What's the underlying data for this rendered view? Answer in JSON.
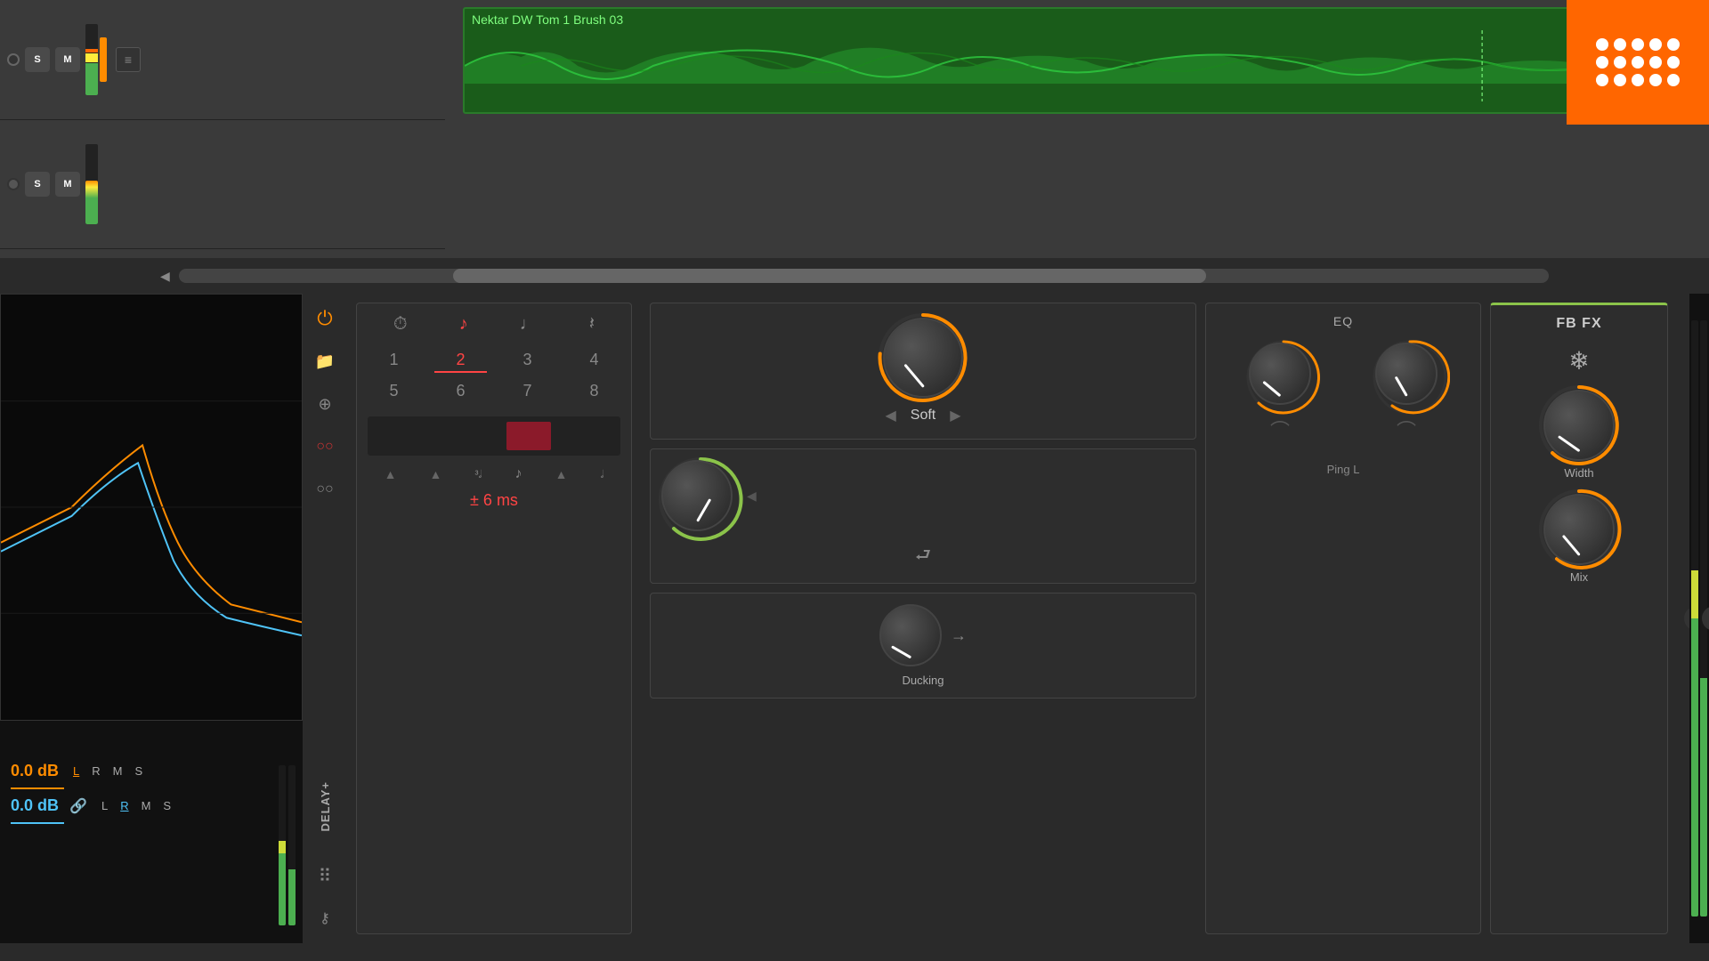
{
  "daw": {
    "track1": {
      "clip_name": "Nektar DW Tom 1 Brush 03",
      "s_label": "S",
      "m_label": "M"
    },
    "track2": {
      "s_label": "S",
      "m_label": "M"
    }
  },
  "plugin": {
    "name": "DELAY+",
    "power_label": "⏻",
    "folder_label": "🗀",
    "chain_label": "⊕",
    "record_label": "○○",
    "dots_label": "⠿",
    "key_label": "⚷"
  },
  "delay": {
    "note_icons": [
      "⏱",
      "♪",
      "♩",
      "𝄽"
    ],
    "numbers_row1": [
      "1",
      "2",
      "3",
      "4"
    ],
    "numbers_row2": [
      "5",
      "6",
      "7",
      "8"
    ],
    "active_number": "2",
    "ms_label": "± 6 ms",
    "ms_prefix": "±",
    "ms_value": "6 ms"
  },
  "eq": {
    "title": "EQ",
    "section_label": "Ping L"
  },
  "soft": {
    "label": "Soft",
    "left_arrow": "◀",
    "right_arrow": "▶"
  },
  "fbfx": {
    "title": "FB FX",
    "snowflake": "❄",
    "width_label": "Width",
    "mix_label": "Mix"
  },
  "ducking": {
    "label": "Ducking",
    "arrow": "→"
  },
  "levels": {
    "orange_val": "0.0 dB",
    "blue_val": "0.0 dB",
    "l": "L",
    "r": "R",
    "m": "M",
    "s": "S",
    "link_icon": "🔗"
  },
  "add_button": "+",
  "scrollbar": {
    "left_arrow": "◀"
  }
}
